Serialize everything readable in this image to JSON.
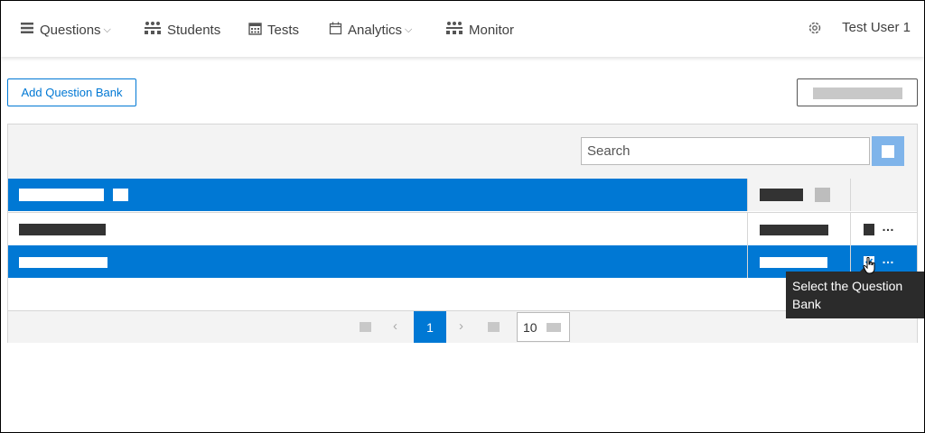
{
  "nav": {
    "items": [
      {
        "label": "Questions",
        "icon": "menu-icon",
        "dropdown": true
      },
      {
        "label": "Students",
        "icon": "students-icon",
        "dropdown": false
      },
      {
        "label": "Tests",
        "icon": "calendar-grid-icon",
        "dropdown": false
      },
      {
        "label": "Analytics",
        "icon": "calendar-icon",
        "dropdown": true
      },
      {
        "label": "Monitor",
        "icon": "monitor-icon",
        "dropdown": false
      }
    ],
    "settings_icon": "gear-icon",
    "user_label": "Test User 1"
  },
  "actions": {
    "add_label": "Add Question Bank"
  },
  "grid": {
    "search_placeholder": "Search",
    "current_page": "1",
    "page_size": "10"
  },
  "tooltip": {
    "text": "Select the Question Bank"
  },
  "colors": {
    "accent": "#0078d4",
    "accent_light": "#7fb4ea",
    "toolbar_bg": "#f3f3f3",
    "tooltip_bg": "#2b2b2b"
  }
}
